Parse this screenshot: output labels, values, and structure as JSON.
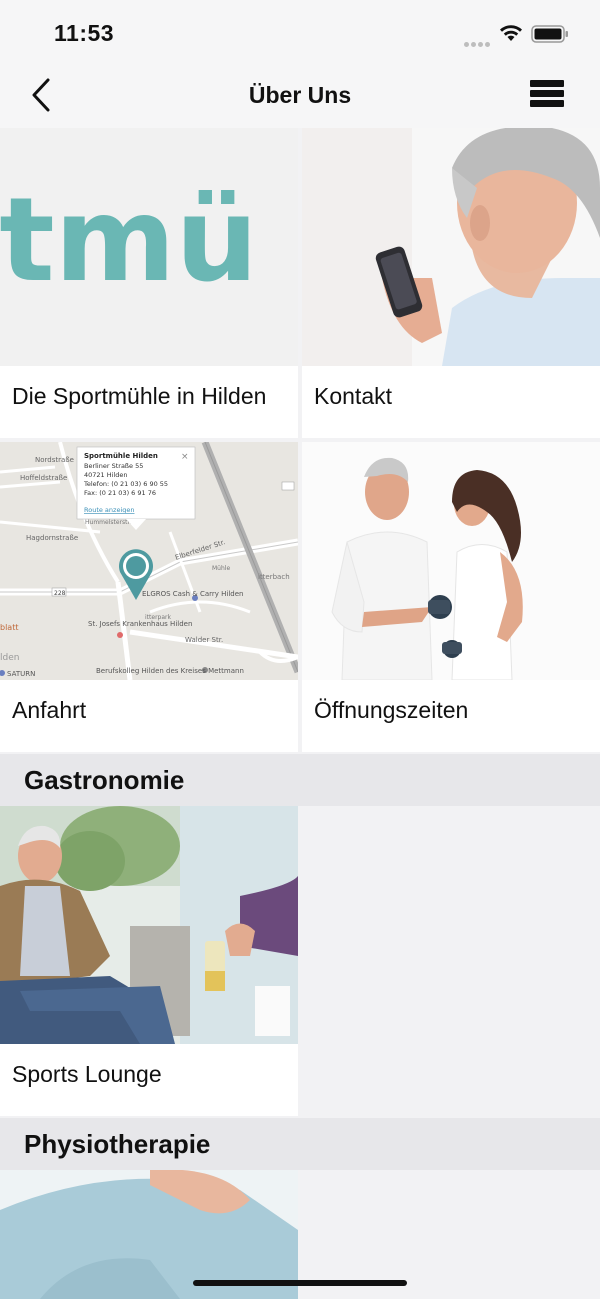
{
  "status": {
    "time": "11:53"
  },
  "nav": {
    "title": "Über Uns"
  },
  "tiles": [
    {
      "label": "Die Sportmühle in Hilden",
      "image_text": "rtmü"
    },
    {
      "label": "Kontakt"
    },
    {
      "label": "Anfahrt"
    },
    {
      "label": "Öffnungszeiten"
    },
    {
      "label": "Sports Lounge"
    }
  ],
  "map": {
    "popup_title": "Sportmühle Hilden",
    "popup_line1": "Berliner Straße 55",
    "popup_line2": "40721 Hilden",
    "popup_line3": "Telefon: (0 21 03) 6 90 55",
    "popup_line4": "Fax: (0 21 03) 6 91 76",
    "popup_link": "Route anzeigen",
    "popup_close": "×",
    "street_1": "Nordstraße",
    "street_2": "Hoffeldstraße",
    "street_3": "Hagdornstraße",
    "street_4": "Elberfelder Str.",
    "street_5": "Walder Str.",
    "street_6": "Hummelsterstr.",
    "street_7": "itterbach",
    "poi_1": "ELGROS Cash & Carry Hilden",
    "poi_2": "St. Josefs Krankenhaus Hilden",
    "poi_3": "Berufskolleg Hilden des Kreises Mettmann",
    "poi_4": "SATURN",
    "poi_5": "lden",
    "poi_6": "blatt",
    "poi_7": "itterpark",
    "poi_8": "Mühle",
    "road_num": "228"
  },
  "sections": [
    {
      "title": "Gastronomie"
    },
    {
      "title": "Physiotherapie"
    }
  ],
  "colors": {
    "teal": "#6ab7b4",
    "map_pin": "#4e9aa0"
  }
}
